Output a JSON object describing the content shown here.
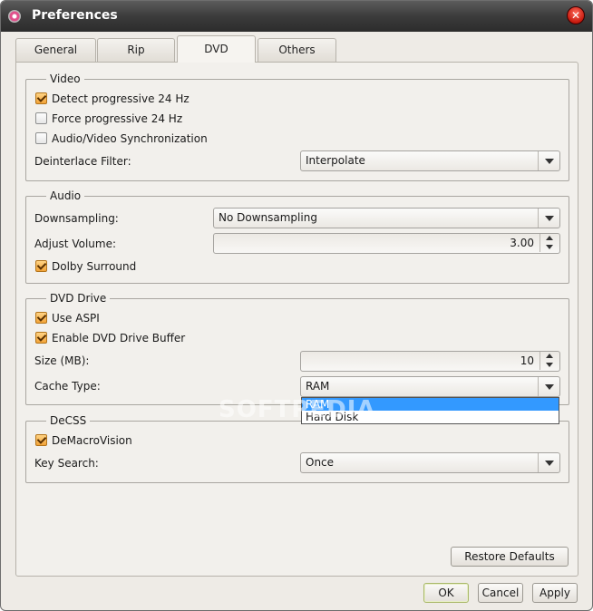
{
  "window": {
    "title": "Preferences"
  },
  "tabs": [
    {
      "label": "General"
    },
    {
      "label": "Rip"
    },
    {
      "label": "DVD"
    },
    {
      "label": "Others"
    }
  ],
  "active_tab": "DVD",
  "video": {
    "title": "Video",
    "detect_progressive": {
      "label": "Detect progressive 24 Hz",
      "checked": true
    },
    "force_progressive": {
      "label": "Force progressive 24 Hz",
      "checked": false
    },
    "av_sync": {
      "label": "Audio/Video Synchronization",
      "checked": false
    },
    "deinterlace_label": "Deinterlace Filter:",
    "deinterlace_value": "Interpolate"
  },
  "audio": {
    "title": "Audio",
    "downsampling_label": "Downsampling:",
    "downsampling_value": "No Downsampling",
    "volume_label": "Adjust Volume:",
    "volume_value": "3.00",
    "dolby": {
      "label": "Dolby Surround",
      "checked": true
    }
  },
  "dvd_drive": {
    "title": "DVD Drive",
    "use_aspi": {
      "label": "Use ASPI",
      "checked": true
    },
    "enable_buffer": {
      "label": "Enable DVD Drive Buffer",
      "checked": true
    },
    "size_label": "Size (MB):",
    "size_value": "10",
    "cache_label": "Cache Type:",
    "cache_value": "RAM",
    "cache_options": [
      "RAM",
      "Hard Disk"
    ]
  },
  "decss": {
    "title": "DeCSS",
    "demacrovision": {
      "label": "DeMacroVision",
      "checked": true
    },
    "key_search_label": "Key Search:",
    "key_search_value": "Once"
  },
  "buttons": {
    "restore_defaults": "Restore Defaults",
    "ok": "OK",
    "cancel": "Cancel",
    "apply": "Apply"
  },
  "watermark": "SOFTPEDIA",
  "colors": {
    "titlebar": "#3b3b3b",
    "checkbox_checked": "#f2a338",
    "selection": "#3399ff"
  }
}
